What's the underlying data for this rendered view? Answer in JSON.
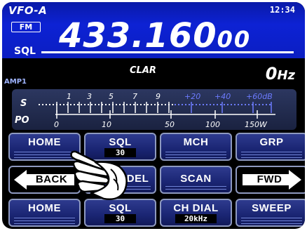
{
  "header": {
    "vfo": "VFO-A",
    "clock": "12:34",
    "mode": "FM",
    "sql_label": "SQL",
    "frequency_main": "433.160",
    "frequency_sub": "00"
  },
  "clar": {
    "amp_label": "AMP1",
    "label": "CLAR",
    "value": "0",
    "unit": "Hz"
  },
  "meter": {
    "s_label": "S",
    "po_label": "PO",
    "s_scale": [
      "1",
      "3",
      "5",
      "7",
      "9",
      "+20",
      "+40",
      "+60dB"
    ],
    "po_scale": [
      "0",
      "10",
      "50",
      "100",
      "150W"
    ],
    "colors": {
      "s_low": "#ffffff",
      "s_high": "#6c7bff"
    }
  },
  "buttons": {
    "row1": [
      {
        "label": "HOME"
      },
      {
        "label": "SQL",
        "value": "30"
      },
      {
        "label": "MCH"
      },
      {
        "label": "GRP"
      }
    ],
    "row2": [
      {
        "label": "BACK"
      },
      {
        "label": "DEL"
      },
      {
        "label": "SCAN"
      },
      {
        "label": "FWD"
      }
    ],
    "row3": [
      {
        "label": "HOME"
      },
      {
        "label": "SQL",
        "value": "30"
      },
      {
        "label": "CH DIAL",
        "value": "20kHz"
      },
      {
        "label": "SWEEP"
      }
    ]
  },
  "colors": {
    "vfo_band": "#0d22d4",
    "button_fill": "#1a2573",
    "button_border": "#8e99c0"
  },
  "icons": {
    "pointer": "hand-pointer-icon"
  }
}
